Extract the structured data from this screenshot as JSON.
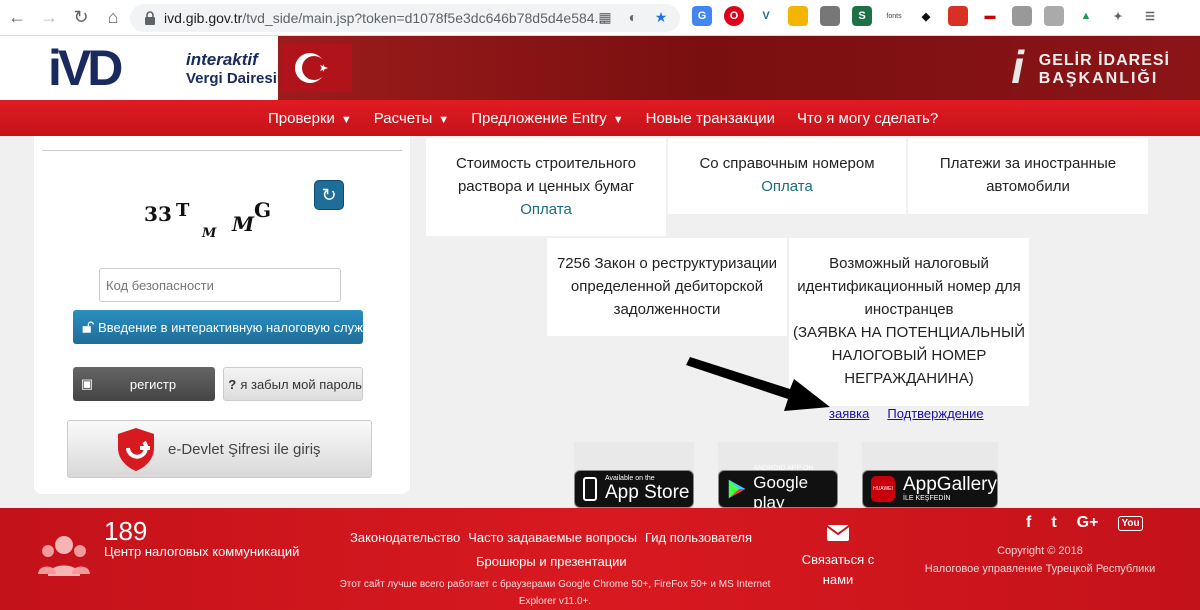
{
  "browser": {
    "url_host": "ivd.gib.gov.tr",
    "url_path": "/tvd_side/main.jsp?token=d1078f5e3dc646b78d5d4e584..."
  },
  "header": {
    "logo_main": "iVD",
    "logo_line1": "interaktif",
    "logo_line2": "Vergi Dairesi",
    "gib_line1": "GELİR İDARESİ",
    "gib_line2": "BAŞKANLIĞI"
  },
  "menu": {
    "items": [
      {
        "label": "Проверки",
        "has_caret": true
      },
      {
        "label": "Расчеты",
        "has_caret": true
      },
      {
        "label": "Предложение Entry",
        "has_caret": true
      },
      {
        "label": "Новые транзакции",
        "has_caret": false
      },
      {
        "label": "Что я могу сделать?",
        "has_caret": false
      }
    ],
    "caret": "▼"
  },
  "login": {
    "captcha_chars": [
      "3",
      "3",
      "T",
      "M",
      "M",
      "G"
    ],
    "code_placeholder": "Код безопасности",
    "login_label": "Введение в интерактивную налоговую служ",
    "register_label": "регистр",
    "forgot_label": "я забыл мой пароль",
    "forgot_icon_text": "?",
    "edevlet_label": "e-Devlet Şifresi ile giriş"
  },
  "tiles": {
    "t1": {
      "text1": "Стоимость строительного",
      "text2": "раствора и ценных бумаг",
      "link": "Оплата"
    },
    "t2": {
      "text1": "Со справочным номером",
      "link": "Оплата"
    },
    "t3": {
      "text1": "Платежи за иностранные",
      "text2": "автомобили"
    },
    "t4": {
      "text1": "7256 Закон о реструктуризации",
      "text2": "определенной дебиторской",
      "text3": "задолженности"
    },
    "t5": {
      "text1": "Возможный налоговый",
      "text2": "идентификационный номер для",
      "text3": "иностранцев",
      "text4": "(ЗАЯВКА НА ПОТЕНЦИАЛЬНЫЙ",
      "text5": "НАЛОГОВЫЙ НОМЕР",
      "text6": "НЕГРАЖДАНИНА)"
    }
  },
  "links": {
    "apply": "заявка",
    "confirm": "Подтверждение"
  },
  "apps": {
    "appstore_small": "Available on the",
    "appstore_big": "App Store",
    "googleplay_small": "ANDROID APP ON",
    "googleplay_big": "Google play",
    "appgallery_big": "AppGallery",
    "appgallery_small": "İLE KEŞFEDİN",
    "huawei": "HUAWEI"
  },
  "footer": {
    "number": "189",
    "center_label": "Центр налоговых коммуникаций",
    "links": [
      "Законодательство",
      "Часто задаваемые вопросы",
      "Гид пользователя"
    ],
    "brochures": "Брошюры и презентации",
    "browser_note": "Этот сайт лучше всего работает с браузерами Google Chrome 50+, FireFox 50+ и MS Internet Explorer v11.0+.",
    "contact_label": "Связаться с нами",
    "copyright": "Copyright © 2018",
    "authority": "Налоговое управление Турецкой Республики",
    "social": [
      "f",
      "t",
      "G+",
      "You"
    ]
  }
}
